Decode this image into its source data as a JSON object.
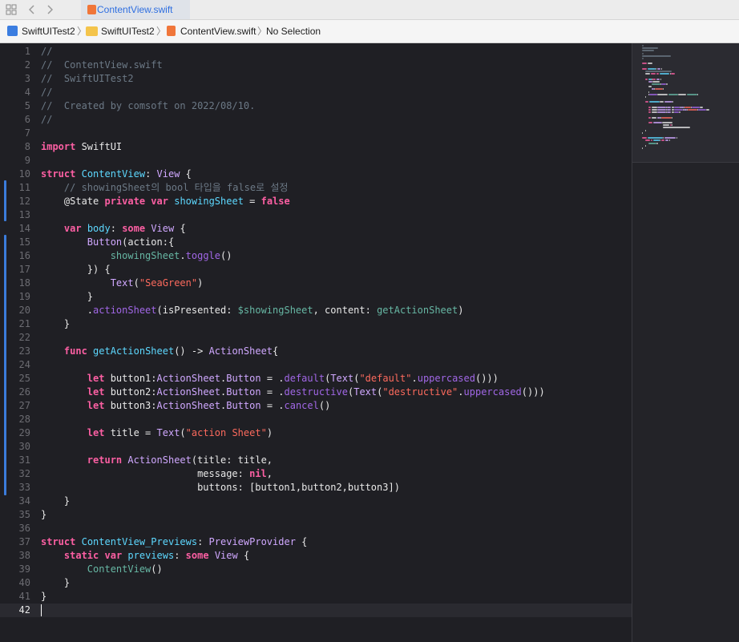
{
  "tabbar": {
    "active_tab": "ContentView.swift"
  },
  "jumpbar": {
    "project": "SwiftUITest2",
    "folder": "SwiftUITest2",
    "file": "ContentView.swift",
    "selection": "No Selection"
  },
  "icons": [
    "grid-icon",
    "back-chevron-icon",
    "forward-chevron-icon",
    "swift-file-icon",
    "project-icon",
    "folder-icon"
  ],
  "colors": {
    "keyword": "#fc5fa3",
    "comment": "#6c7986",
    "string": "#fc6a5d",
    "type": "#d0a8ff",
    "declaration": "#5dd8ff",
    "method": "#a167e6",
    "project_ref": "#67b7a4",
    "plain": "#e8e8e8",
    "change_bar": "#3b7cdb"
  },
  "current_line": 42,
  "code_lines": [
    [
      {
        "t": "//",
        "c": "comment"
      }
    ],
    [
      {
        "t": "//  ContentView.swift",
        "c": "comment"
      }
    ],
    [
      {
        "t": "//  SwiftUITest2",
        "c": "comment"
      }
    ],
    [
      {
        "t": "//",
        "c": "comment"
      }
    ],
    [
      {
        "t": "//  Created by comsoft on 2022/08/10.",
        "c": "comment"
      }
    ],
    [
      {
        "t": "//",
        "c": "comment"
      }
    ],
    [],
    [
      {
        "t": "import",
        "c": "keyword"
      },
      {
        "t": " SwiftUI",
        "c": "plain"
      }
    ],
    [],
    [
      {
        "t": "struct",
        "c": "keyword"
      },
      {
        "t": " ",
        "c": "plain"
      },
      {
        "t": "ContentView",
        "c": "declaration"
      },
      {
        "t": ": ",
        "c": "plain"
      },
      {
        "t": "View",
        "c": "type"
      },
      {
        "t": " {",
        "c": "plain"
      }
    ],
    [
      {
        "t": "    // showingSheet의 bool 타입을 false로 설정",
        "c": "comment"
      }
    ],
    [
      {
        "t": "    @State ",
        "c": "plain"
      },
      {
        "t": "private",
        "c": "keyword"
      },
      {
        "t": " ",
        "c": "plain"
      },
      {
        "t": "var",
        "c": "keyword"
      },
      {
        "t": " ",
        "c": "plain"
      },
      {
        "t": "showingSheet",
        "c": "declaration"
      },
      {
        "t": " = ",
        "c": "plain"
      },
      {
        "t": "false",
        "c": "keyword"
      }
    ],
    [],
    [
      {
        "t": "    ",
        "c": "plain"
      },
      {
        "t": "var",
        "c": "keyword"
      },
      {
        "t": " ",
        "c": "plain"
      },
      {
        "t": "body",
        "c": "declaration"
      },
      {
        "t": ": ",
        "c": "plain"
      },
      {
        "t": "some",
        "c": "keyword"
      },
      {
        "t": " ",
        "c": "plain"
      },
      {
        "t": "View",
        "c": "type"
      },
      {
        "t": " {",
        "c": "plain"
      }
    ],
    [
      {
        "t": "        ",
        "c": "plain"
      },
      {
        "t": "Button",
        "c": "type"
      },
      {
        "t": "(action:{",
        "c": "plain"
      }
    ],
    [
      {
        "t": "            ",
        "c": "plain"
      },
      {
        "t": "showingSheet",
        "c": "project_ref"
      },
      {
        "t": ".",
        "c": "plain"
      },
      {
        "t": "toggle",
        "c": "method"
      },
      {
        "t": "()",
        "c": "plain"
      }
    ],
    [
      {
        "t": "        }) {",
        "c": "plain"
      }
    ],
    [
      {
        "t": "            ",
        "c": "plain"
      },
      {
        "t": "Text",
        "c": "type"
      },
      {
        "t": "(",
        "c": "plain"
      },
      {
        "t": "\"SeaGreen\"",
        "c": "string"
      },
      {
        "t": ")",
        "c": "plain"
      }
    ],
    [
      {
        "t": "        }",
        "c": "plain"
      }
    ],
    [
      {
        "t": "        .",
        "c": "plain"
      },
      {
        "t": "actionSheet",
        "c": "method"
      },
      {
        "t": "(isPresented: ",
        "c": "plain"
      },
      {
        "t": "$showingSheet",
        "c": "project_ref"
      },
      {
        "t": ", content: ",
        "c": "plain"
      },
      {
        "t": "getActionSheet",
        "c": "project_ref"
      },
      {
        "t": ")",
        "c": "plain"
      }
    ],
    [
      {
        "t": "    }",
        "c": "plain"
      }
    ],
    [],
    [
      {
        "t": "    ",
        "c": "plain"
      },
      {
        "t": "func",
        "c": "keyword"
      },
      {
        "t": " ",
        "c": "plain"
      },
      {
        "t": "getActionSheet",
        "c": "declaration"
      },
      {
        "t": "() -> ",
        "c": "plain"
      },
      {
        "t": "ActionSheet",
        "c": "type"
      },
      {
        "t": "{",
        "c": "plain"
      }
    ],
    [],
    [
      {
        "t": "        ",
        "c": "plain"
      },
      {
        "t": "let",
        "c": "keyword"
      },
      {
        "t": " button1:",
        "c": "plain"
      },
      {
        "t": "ActionSheet",
        "c": "type"
      },
      {
        "t": ".",
        "c": "plain"
      },
      {
        "t": "Button",
        "c": "type"
      },
      {
        "t": " = .",
        "c": "plain"
      },
      {
        "t": "default",
        "c": "method"
      },
      {
        "t": "(",
        "c": "plain"
      },
      {
        "t": "Text",
        "c": "type"
      },
      {
        "t": "(",
        "c": "plain"
      },
      {
        "t": "\"default\"",
        "c": "string"
      },
      {
        "t": ".",
        "c": "plain"
      },
      {
        "t": "uppercased",
        "c": "method"
      },
      {
        "t": "()))",
        "c": "plain"
      }
    ],
    [
      {
        "t": "        ",
        "c": "plain"
      },
      {
        "t": "let",
        "c": "keyword"
      },
      {
        "t": " button2:",
        "c": "plain"
      },
      {
        "t": "ActionSheet",
        "c": "type"
      },
      {
        "t": ".",
        "c": "plain"
      },
      {
        "t": "Button",
        "c": "type"
      },
      {
        "t": " = .",
        "c": "plain"
      },
      {
        "t": "destructive",
        "c": "method"
      },
      {
        "t": "(",
        "c": "plain"
      },
      {
        "t": "Text",
        "c": "type"
      },
      {
        "t": "(",
        "c": "plain"
      },
      {
        "t": "\"destructive\"",
        "c": "string"
      },
      {
        "t": ".",
        "c": "plain"
      },
      {
        "t": "uppercased",
        "c": "method"
      },
      {
        "t": "()))",
        "c": "plain"
      }
    ],
    [
      {
        "t": "        ",
        "c": "plain"
      },
      {
        "t": "let",
        "c": "keyword"
      },
      {
        "t": " button3:",
        "c": "plain"
      },
      {
        "t": "ActionSheet",
        "c": "type"
      },
      {
        "t": ".",
        "c": "plain"
      },
      {
        "t": "Button",
        "c": "type"
      },
      {
        "t": " = .",
        "c": "plain"
      },
      {
        "t": "cancel",
        "c": "method"
      },
      {
        "t": "()",
        "c": "plain"
      }
    ],
    [],
    [
      {
        "t": "        ",
        "c": "plain"
      },
      {
        "t": "let",
        "c": "keyword"
      },
      {
        "t": " title = ",
        "c": "plain"
      },
      {
        "t": "Text",
        "c": "type"
      },
      {
        "t": "(",
        "c": "plain"
      },
      {
        "t": "\"action Sheet\"",
        "c": "string"
      },
      {
        "t": ")",
        "c": "plain"
      }
    ],
    [],
    [
      {
        "t": "        ",
        "c": "plain"
      },
      {
        "t": "return",
        "c": "keyword"
      },
      {
        "t": " ",
        "c": "plain"
      },
      {
        "t": "ActionSheet",
        "c": "type"
      },
      {
        "t": "(title: title,",
        "c": "plain"
      }
    ],
    [
      {
        "t": "                           message: ",
        "c": "plain"
      },
      {
        "t": "nil",
        "c": "keyword"
      },
      {
        "t": ",",
        "c": "plain"
      }
    ],
    [
      {
        "t": "                           buttons: [button1,button2,button3])",
        "c": "plain"
      }
    ],
    [
      {
        "t": "    }",
        "c": "plain"
      }
    ],
    [
      {
        "t": "}",
        "c": "plain"
      }
    ],
    [],
    [
      {
        "t": "struct",
        "c": "keyword"
      },
      {
        "t": " ",
        "c": "plain"
      },
      {
        "t": "ContentView_Previews",
        "c": "declaration"
      },
      {
        "t": ": ",
        "c": "plain"
      },
      {
        "t": "PreviewProvider",
        "c": "type"
      },
      {
        "t": " {",
        "c": "plain"
      }
    ],
    [
      {
        "t": "    ",
        "c": "plain"
      },
      {
        "t": "static",
        "c": "keyword"
      },
      {
        "t": " ",
        "c": "plain"
      },
      {
        "t": "var",
        "c": "keyword"
      },
      {
        "t": " ",
        "c": "plain"
      },
      {
        "t": "previews",
        "c": "declaration"
      },
      {
        "t": ": ",
        "c": "plain"
      },
      {
        "t": "some",
        "c": "keyword"
      },
      {
        "t": " ",
        "c": "plain"
      },
      {
        "t": "View",
        "c": "type"
      },
      {
        "t": " {",
        "c": "plain"
      }
    ],
    [
      {
        "t": "        ",
        "c": "plain"
      },
      {
        "t": "ContentView",
        "c": "project_ref"
      },
      {
        "t": "()",
        "c": "plain"
      }
    ],
    [
      {
        "t": "    }",
        "c": "plain"
      }
    ],
    [
      {
        "t": "}",
        "c": "plain"
      }
    ],
    []
  ]
}
